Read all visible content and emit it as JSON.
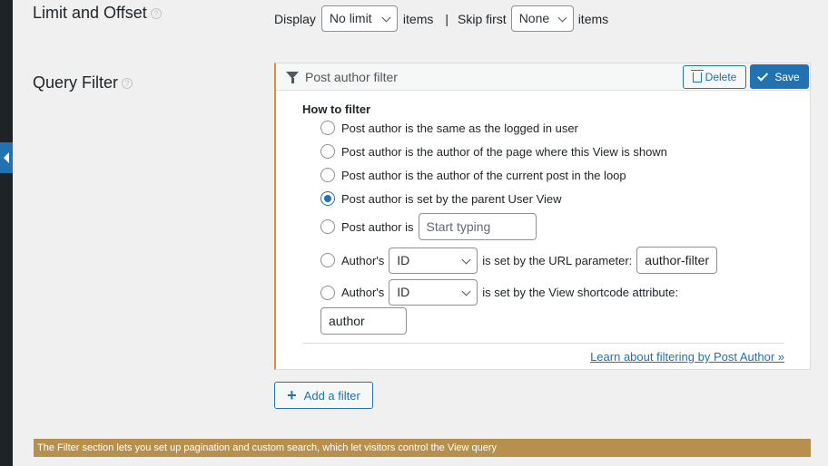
{
  "limit": {
    "title": "Limit and Offset",
    "display_label": "Display",
    "display_value": "No limit",
    "items_label": "items",
    "separator": "|",
    "skip_label": "Skip first",
    "skip_value": "None",
    "items_label_2": "items"
  },
  "filter": {
    "title": "Query Filter",
    "panel_title": "Post author filter",
    "delete_label": "Delete",
    "save_label": "Save",
    "how_label": "How to filter",
    "options": [
      "Post author is the same as the logged in user",
      "Post author is the author of the page where this View is shown",
      "Post author is the author of the current post in the loop",
      "Post author is set by the parent User View",
      "Post author is",
      "Author's",
      "Author's"
    ],
    "selected_option": 3,
    "start_typing_placeholder": "Start typing",
    "url_select_value": "ID",
    "url_text": "is set by the URL parameter:",
    "url_param_value": "author-filter",
    "shortcode_select_value": "ID",
    "shortcode_text": "is set by the View shortcode attribute:",
    "shortcode_attr_value": "author",
    "learn_link": "Learn about filtering by Post Author »"
  },
  "add_filter_label": "Add a filter",
  "notice": "The Filter section lets you set up pagination and custom search, which let visitors control the View query",
  "colors": {
    "accent": "#2271b1",
    "panel_border": "#e48c3c",
    "notice_bg": "#b7904e",
    "sidebar": "#1d2327"
  }
}
